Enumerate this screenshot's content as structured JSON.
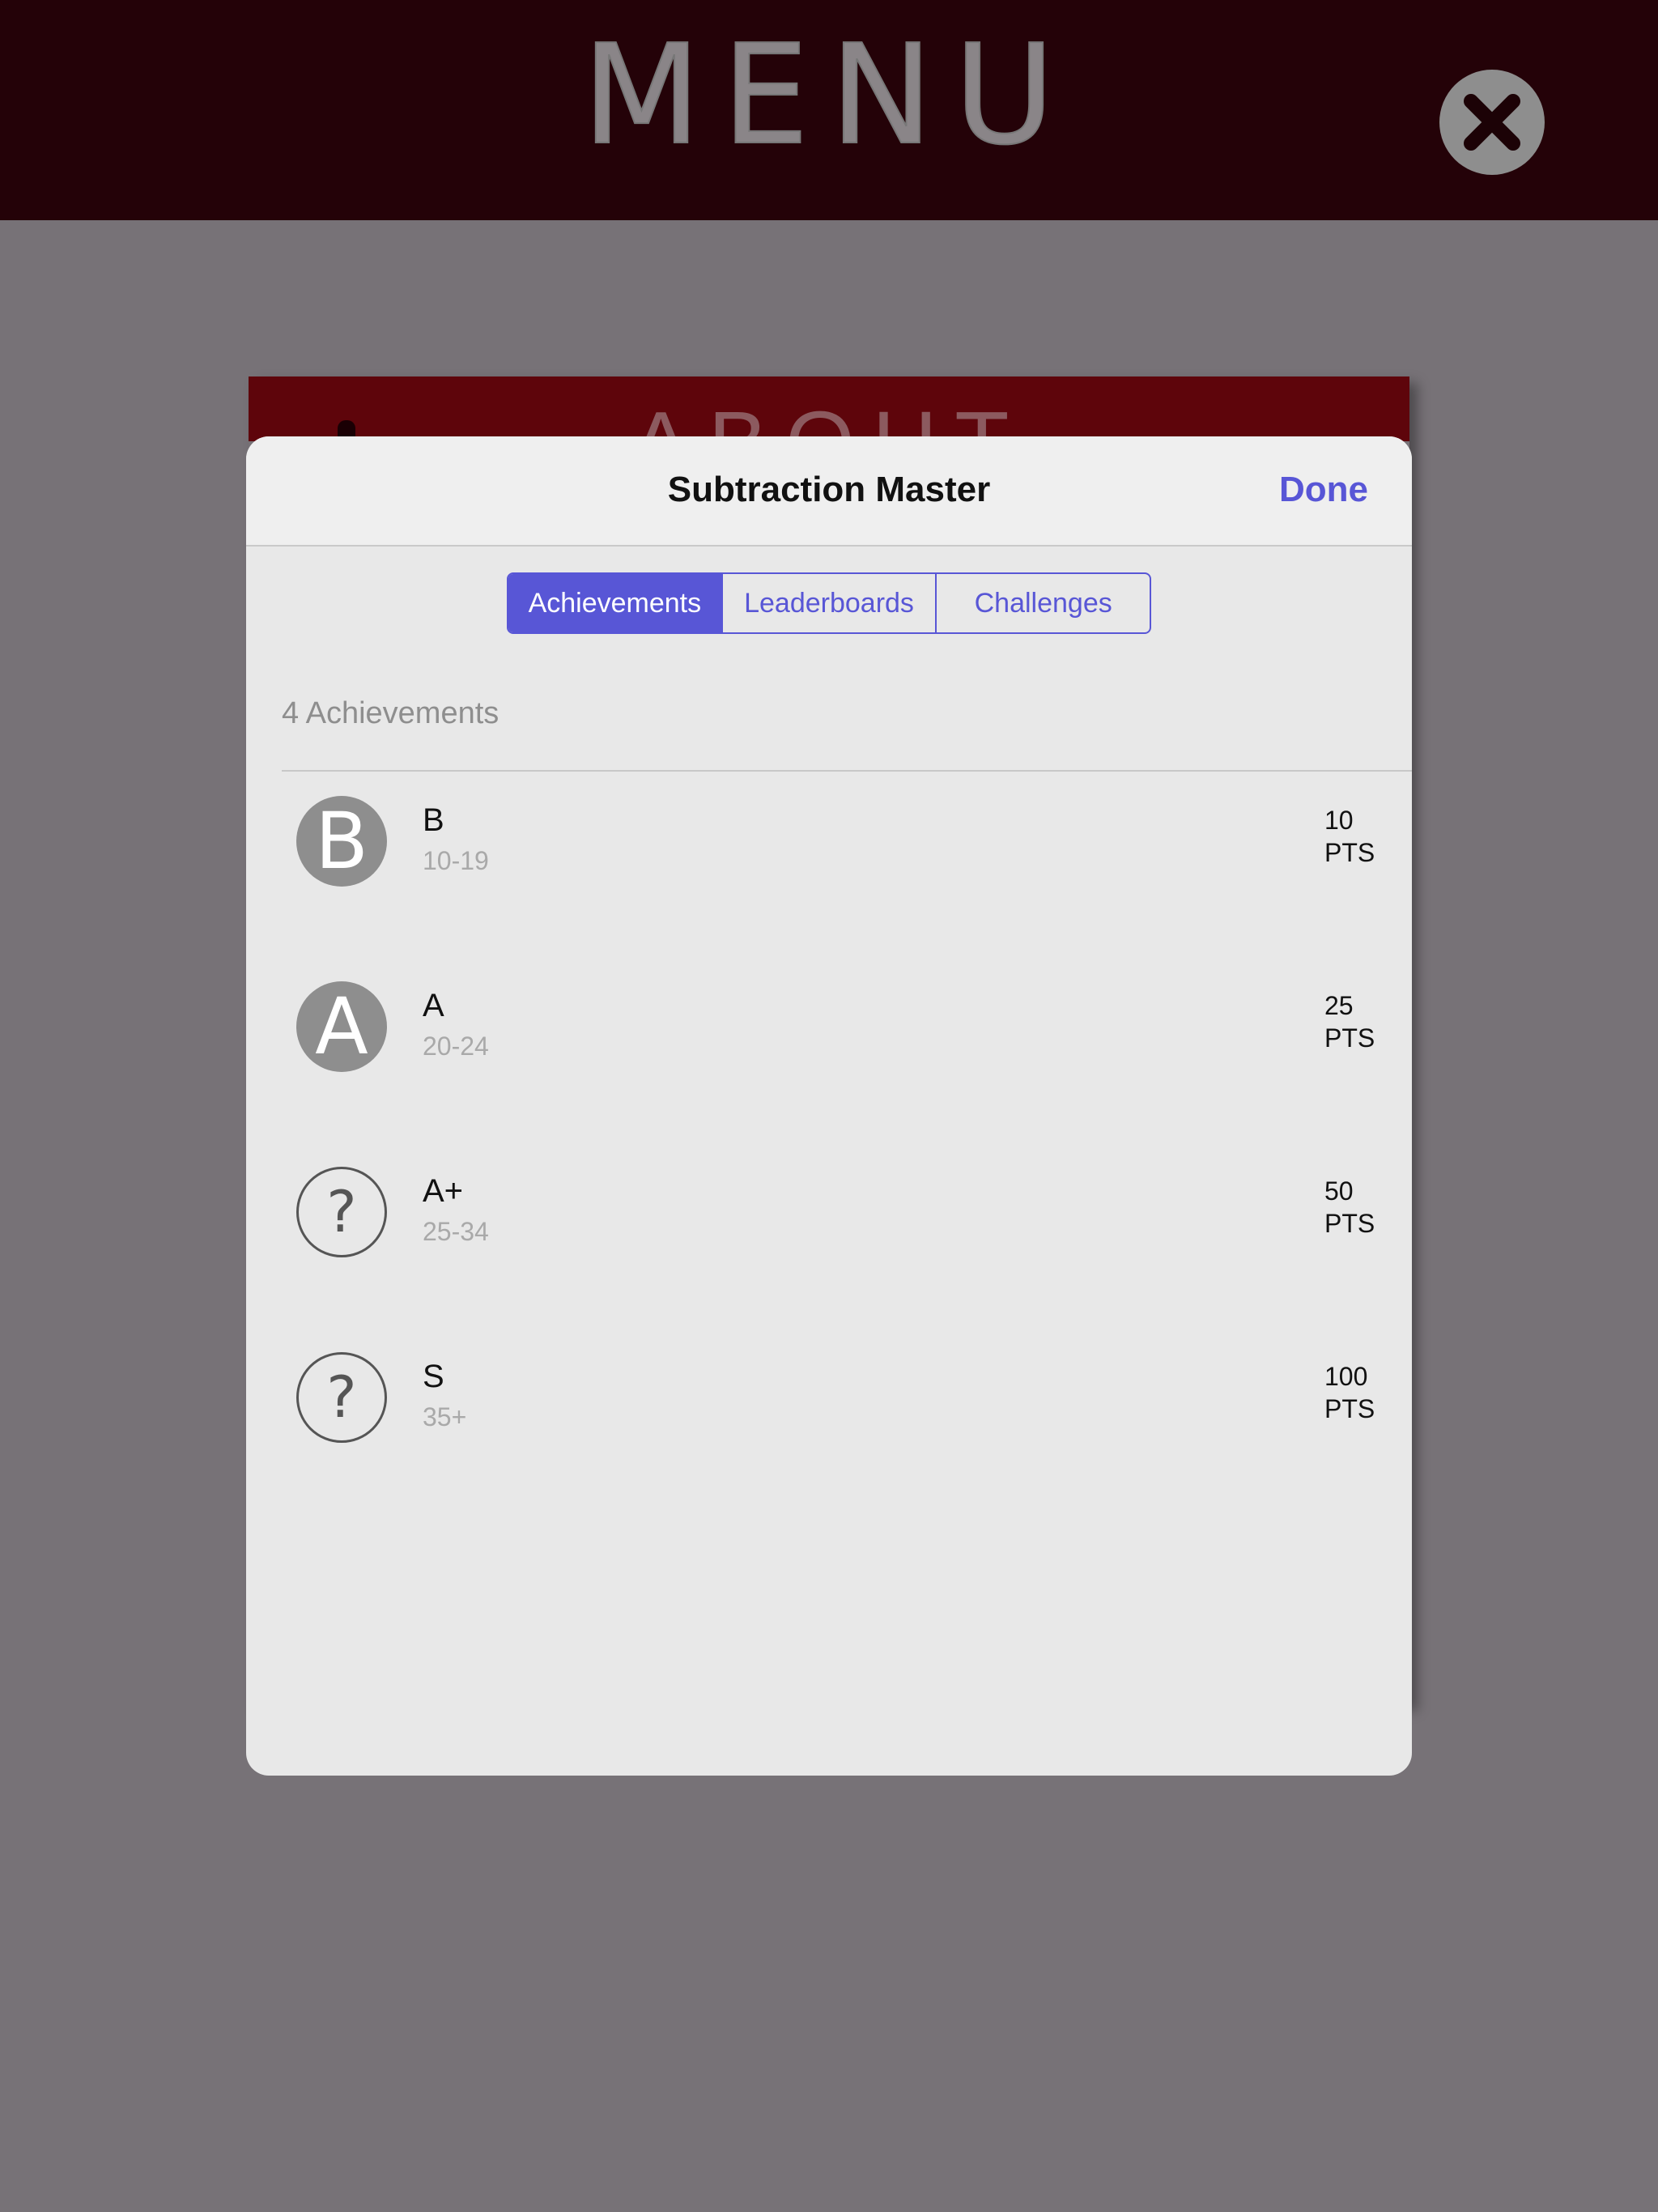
{
  "menu": {
    "title": "MENU"
  },
  "background_card": {
    "title": "ABOUT"
  },
  "modal": {
    "title": "Subtraction Master",
    "done_label": "Done",
    "tabs": [
      {
        "label": "Achievements",
        "active": true
      },
      {
        "label": "Leaderboards",
        "active": false
      },
      {
        "label": "Challenges",
        "active": false
      }
    ],
    "section_header": "4 Achievements",
    "achievements": [
      {
        "title": "B",
        "range": "10-19",
        "points": "10",
        "points_unit": "PTS",
        "badge": "B",
        "earned": true
      },
      {
        "title": "A",
        "range": "20-24",
        "points": "25",
        "points_unit": "PTS",
        "badge": "A",
        "earned": true
      },
      {
        "title": "A+",
        "range": "25-34",
        "points": "50",
        "points_unit": "PTS",
        "badge": "?",
        "earned": false
      },
      {
        "title": "S",
        "range": "35+",
        "points": "100",
        "points_unit": "PTS",
        "badge": "?",
        "earned": false
      }
    ]
  },
  "colors": {
    "accent": "#5856d6",
    "menu_bar": "#240208",
    "overlay": "#777277"
  }
}
